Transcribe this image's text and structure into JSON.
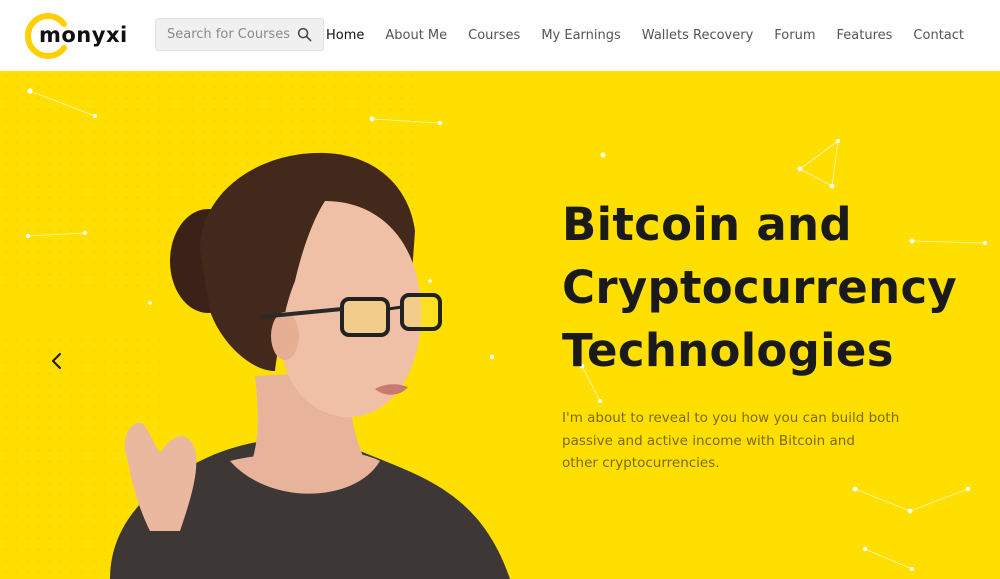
{
  "brand": {
    "name": "monyxi",
    "accent_color": "#ffdf00"
  },
  "search": {
    "placeholder": "Search for Courses",
    "icon": "search-icon"
  },
  "nav": {
    "items": [
      {
        "label": "Home",
        "active": true
      },
      {
        "label": "About Me"
      },
      {
        "label": "Courses"
      },
      {
        "label": "My Earnings"
      },
      {
        "label": "Wallets Recovery"
      },
      {
        "label": "Forum"
      },
      {
        "label": "Features"
      },
      {
        "label": "Contact"
      }
    ]
  },
  "hero": {
    "title_lines": [
      "Bitcoin and",
      "Cryptocurrency",
      "Technologies"
    ],
    "text_lines": [
      "I'm about to reveal to you how you can build both",
      "passive and active income with Bitcoin and",
      "other cryptocurrencies."
    ],
    "background_color": "#ffdf00",
    "prev_icon": "chevron-left-icon"
  }
}
